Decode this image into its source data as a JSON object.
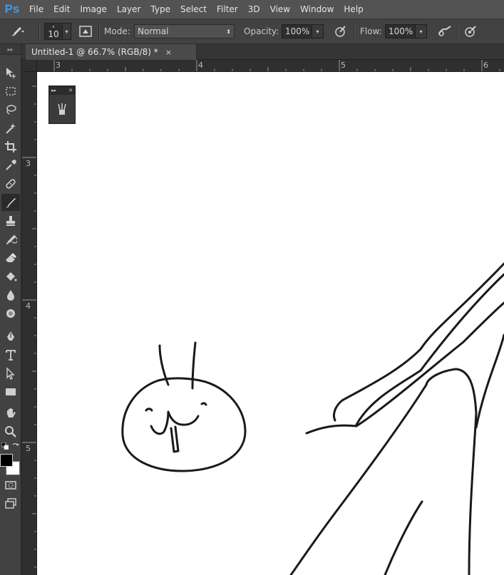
{
  "app": {
    "logo_text": "Ps"
  },
  "menu": [
    "File",
    "Edit",
    "Image",
    "Layer",
    "Type",
    "Select",
    "Filter",
    "3D",
    "View",
    "Window",
    "Help"
  ],
  "options": {
    "brush_size": "10",
    "mode_label": "Mode:",
    "mode_value": "Normal",
    "opacity_label": "Opacity:",
    "opacity_value": "100%",
    "flow_label": "Flow:",
    "flow_value": "100%"
  },
  "document_tab": {
    "title": "Untitled-1 @ 66.7% (RGB/8) *",
    "close": "×"
  },
  "ruler": {
    "horizontal": [
      "3",
      "4",
      "5",
      "6"
    ],
    "vertical": [
      "3",
      "4",
      "5"
    ]
  },
  "colors": {
    "foreground": "#000000",
    "background": "#ffffff",
    "accent": "#3d9be9"
  },
  "tools": [
    "move-icon",
    "marquee-icon",
    "lasso-icon",
    "magic-wand-icon",
    "crop-icon",
    "eyedropper-icon",
    "healing-brush-icon",
    "brush-icon",
    "clone-stamp-icon",
    "history-brush-icon",
    "eraser-icon",
    "paint-bucket-icon",
    "blur-icon",
    "dodge-icon",
    "pen-icon",
    "type-icon",
    "path-selection-icon",
    "rectangle-icon",
    "hand-icon",
    "zoom-icon"
  ],
  "active_tool": "brush-icon"
}
